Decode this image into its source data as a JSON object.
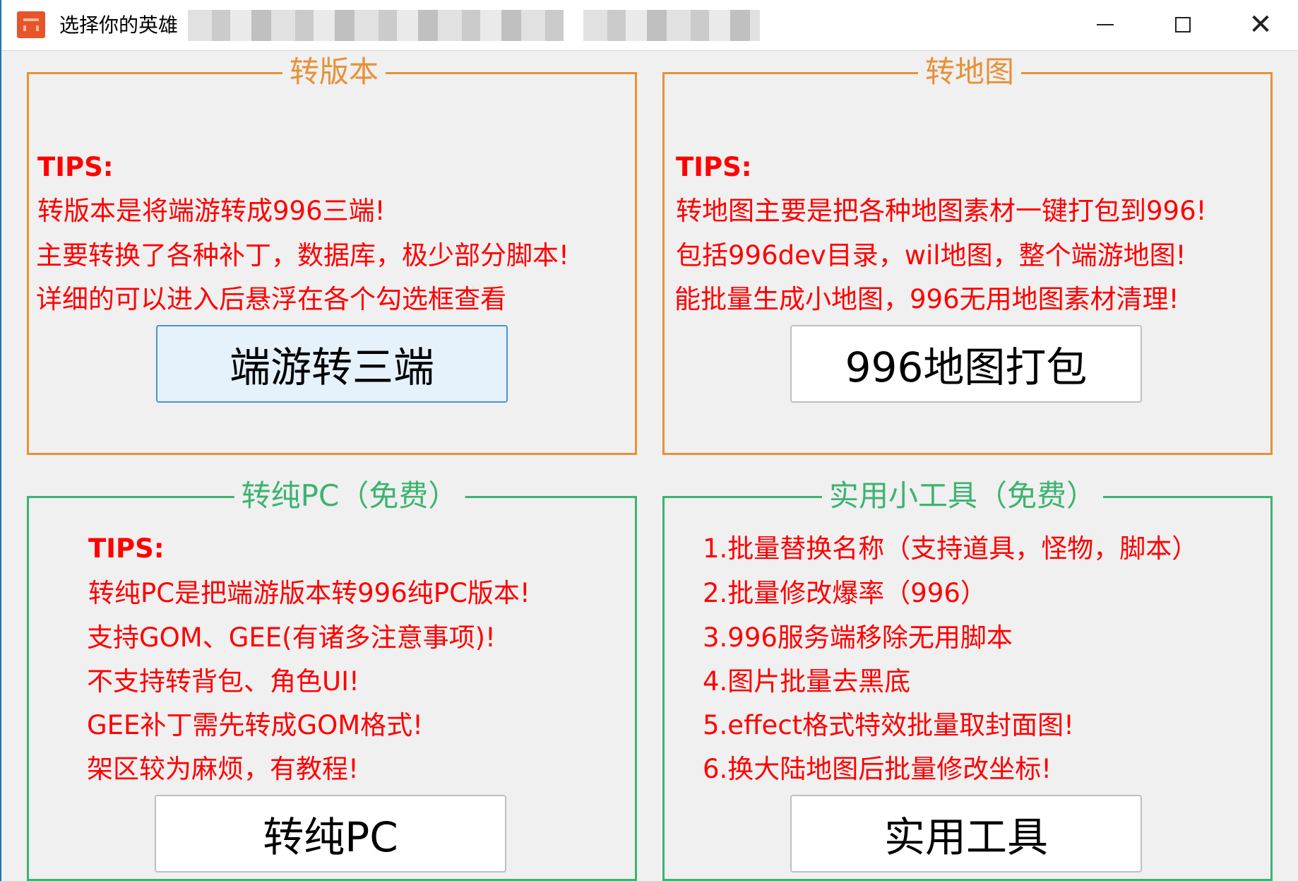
{
  "window": {
    "title": "选择你的英雄",
    "controls": {
      "minimize": "minimize",
      "maximize": "maximize",
      "close": "✕"
    }
  },
  "panels": {
    "convert_version": {
      "title": "转版本",
      "lines": [
        "TIPS:",
        "转版本是将端游转成996三端!",
        "主要转换了各种补丁，数据库，极少部分脚本!",
        "详细的可以进入后悬浮在各个勾选框查看"
      ],
      "button": "端游转三端"
    },
    "convert_map": {
      "title": "转地图",
      "lines": [
        "TIPS:",
        "转地图主要是把各种地图素材一键打包到996!",
        "包括996dev目录，wil地图，整个端游地图!",
        "能批量生成小地图，996无用地图素材清理!"
      ],
      "button": "996地图打包"
    },
    "convert_pc": {
      "title": "转纯PC（免费）",
      "lines": [
        "TIPS:",
        "转纯PC是把端游版本转996纯PC版本!",
        "支持GOM、GEE(有诸多注意事项)!",
        "不支持转背包、角色UI!",
        "GEE补丁需先转成GOM格式!",
        "架区较为麻烦，有教程!"
      ],
      "button": "转纯PC"
    },
    "tools": {
      "title": "实用小工具（免费）",
      "lines": [
        "1.批量替换名称（支持道具，怪物，脚本）",
        "2.批量修改爆率（996）",
        "3.996服务端移除无用脚本",
        "4.图片批量去黑底",
        "5.effect格式特效批量取封面图!",
        "6.换大陆地图后批量修改坐标!"
      ],
      "button": "实用工具"
    }
  },
  "colors": {
    "orange_border": "#e69138",
    "green_border": "#3cb371",
    "tips_text": "#ff0000"
  }
}
